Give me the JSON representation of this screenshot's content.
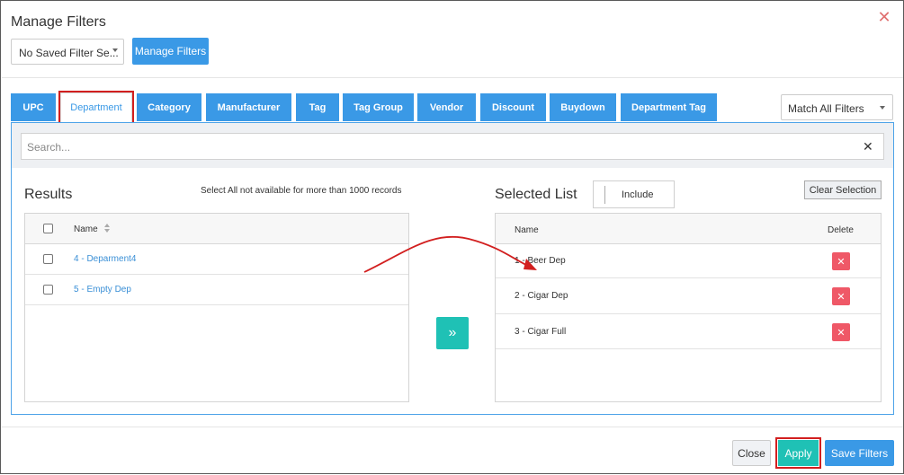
{
  "dialog": {
    "title": "Manage Filters"
  },
  "saved_filter": {
    "value": "No Saved Filter Se..."
  },
  "manage_filters_label": "Manage Filters",
  "tabs": [
    {
      "label": "UPC",
      "active": false
    },
    {
      "label": "Department",
      "active": true
    },
    {
      "label": "Category",
      "active": false
    },
    {
      "label": "Manufacturer",
      "active": false
    },
    {
      "label": "Tag",
      "active": false
    },
    {
      "label": "Tag Group",
      "active": false
    },
    {
      "label": "Vendor",
      "active": false
    },
    {
      "label": "Discount",
      "active": false
    },
    {
      "label": "Buydown",
      "active": false
    },
    {
      "label": "Department Tag",
      "active": false
    }
  ],
  "match_select": {
    "value": "Match All Filters"
  },
  "search": {
    "placeholder": "Search..."
  },
  "results": {
    "title": "Results",
    "note": "Select All not available for more than 1000 records",
    "header_name": "Name",
    "rows": [
      "4 - Deparment4",
      "5 - Empty Dep"
    ]
  },
  "selected": {
    "title": "Selected List",
    "include_label": "Include",
    "clear_label": "Clear Selection",
    "header_name": "Name",
    "header_delete": "Delete",
    "rows": [
      "1 - Beer Dep",
      "2 - Cigar Dep",
      "3 - Cigar Full"
    ]
  },
  "footer": {
    "close_label": "Close",
    "apply_label": "Apply",
    "save_label": "Save Filters"
  },
  "colors": {
    "primary": "#3a99e6",
    "teal": "#1fc1b5",
    "danger": "#ef5867",
    "highlight": "#d21f1f"
  },
  "icons": {
    "close": "close-icon",
    "move": "double-chevron-right-icon",
    "delete": "times-icon",
    "sort": "sort-icon"
  }
}
